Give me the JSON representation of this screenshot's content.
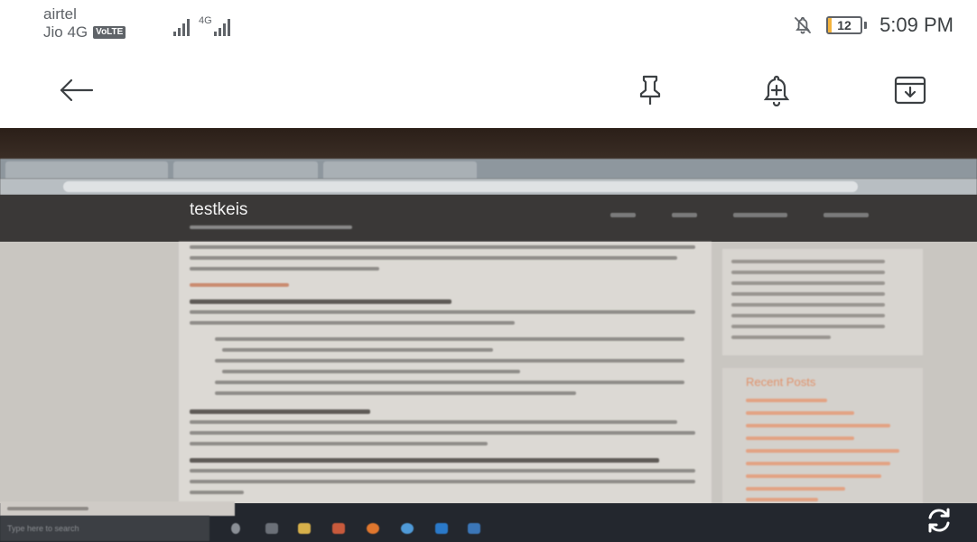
{
  "status": {
    "carrier1": "airtel",
    "carrier2": "Jio 4G",
    "volte": "VoLTE",
    "net_type": "4G",
    "battery_text": "12",
    "battery_level": 0.12,
    "time": "5:09 PM"
  },
  "icons": {
    "back": "arrow-left-icon",
    "pin": "pin-icon",
    "reminder": "bell-plus-icon",
    "archive": "archive-icon",
    "rotate": "rotate-icon",
    "notifications": "bell-off-icon"
  },
  "photo": {
    "blog_title": "testkeis",
    "recent_posts": "Recent Posts",
    "taskbar_search": "Type here to search"
  },
  "colors": {
    "battery_fill": "#f3b33d",
    "icon": "#3c4043"
  }
}
